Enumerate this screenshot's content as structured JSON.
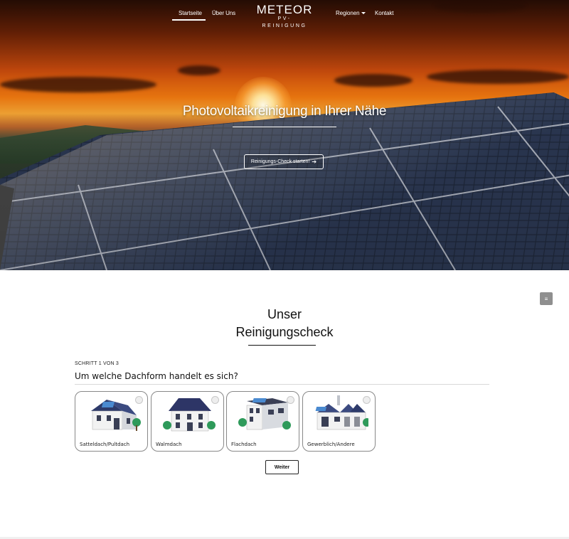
{
  "nav": {
    "left": [
      {
        "label": "Startseite",
        "active": true
      },
      {
        "label": "Über Uns",
        "active": false
      }
    ],
    "right": [
      {
        "label": "Regionen",
        "dropdown": true
      },
      {
        "label": "Kontakt",
        "dropdown": false
      }
    ]
  },
  "logo": {
    "main": "METEOR",
    "sub": "PV-REINIGUNG"
  },
  "hero": {
    "title": "Photovoltaikreinigung in Ihrer Nähe",
    "button": "Reinigungs-Check starten!",
    "button_icon": "arrow-right-icon"
  },
  "section": {
    "title_line1": "Unser",
    "title_line2": "Reinigungscheck"
  },
  "wizard": {
    "step": "SCHRITT 1 VON 3",
    "question": "Um welche Dachform handelt es sich?",
    "options": [
      {
        "label": "Satteldach/Pultdach",
        "icon": "gable-roof-house-icon"
      },
      {
        "label": "Walmdach",
        "icon": "hip-roof-house-icon"
      },
      {
        "label": "Flachdach",
        "icon": "flat-roof-house-icon"
      },
      {
        "label": "Gewerblich/Andere",
        "icon": "commercial-building-icon"
      }
    ],
    "next": "Weiter"
  },
  "side_button_icon": "menu-icon",
  "colors": {
    "accent": "#ffffff",
    "text": "#111111",
    "border": "#888888",
    "side_button": "#8f8f8f"
  }
}
